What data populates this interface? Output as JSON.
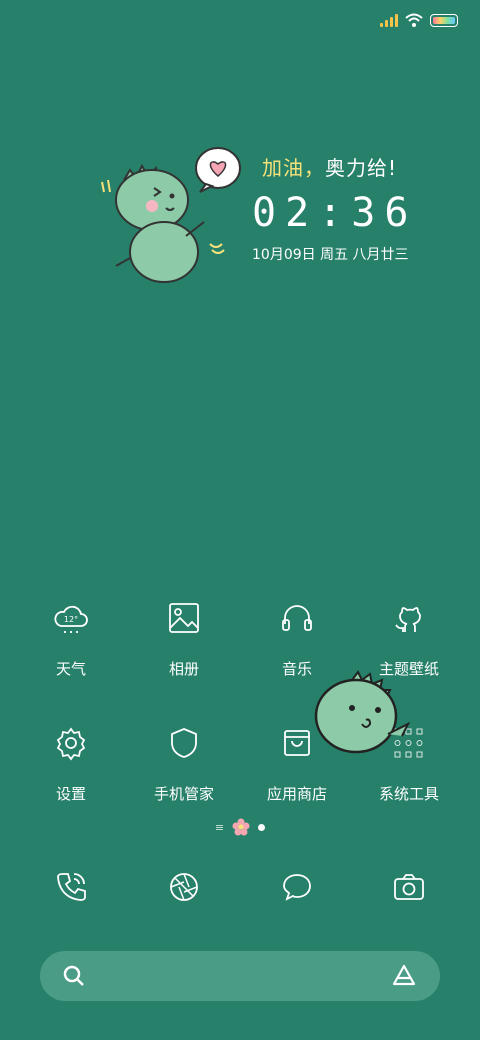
{
  "status_bar": {
    "icons": [
      "signal-icon",
      "wifi-icon",
      "battery-icon"
    ]
  },
  "widget": {
    "greeting_part1": "加油，",
    "greeting_part2": "奥力给!",
    "time": "02:36",
    "date": "10月09日 周五 八月廿三",
    "weather_temp": "12°"
  },
  "apps": [
    {
      "label": "天气",
      "icon": "weather-cloud-icon"
    },
    {
      "label": "相册",
      "icon": "image-icon"
    },
    {
      "label": "音乐",
      "icon": "headphones-icon"
    },
    {
      "label": "主题壁纸",
      "icon": "github-cat-icon"
    },
    {
      "label": "设置",
      "icon": "gear-icon"
    },
    {
      "label": "手机管家",
      "icon": "shield-icon"
    },
    {
      "label": "应用商店",
      "icon": "shopping-bag-icon"
    },
    {
      "label": "系统工具",
      "icon": "tools-folder-icon"
    }
  ],
  "dock": [
    {
      "icon": "phone-icon"
    },
    {
      "icon": "aperture-icon"
    },
    {
      "icon": "message-icon"
    },
    {
      "icon": "camera-icon"
    }
  ],
  "pager": {
    "pages": 3,
    "current": 2
  },
  "colors": {
    "background": "#27806a",
    "search_bg": "#4a9c87",
    "greeting_accent": "#f6e27a",
    "dino": "#8ccaa8"
  }
}
